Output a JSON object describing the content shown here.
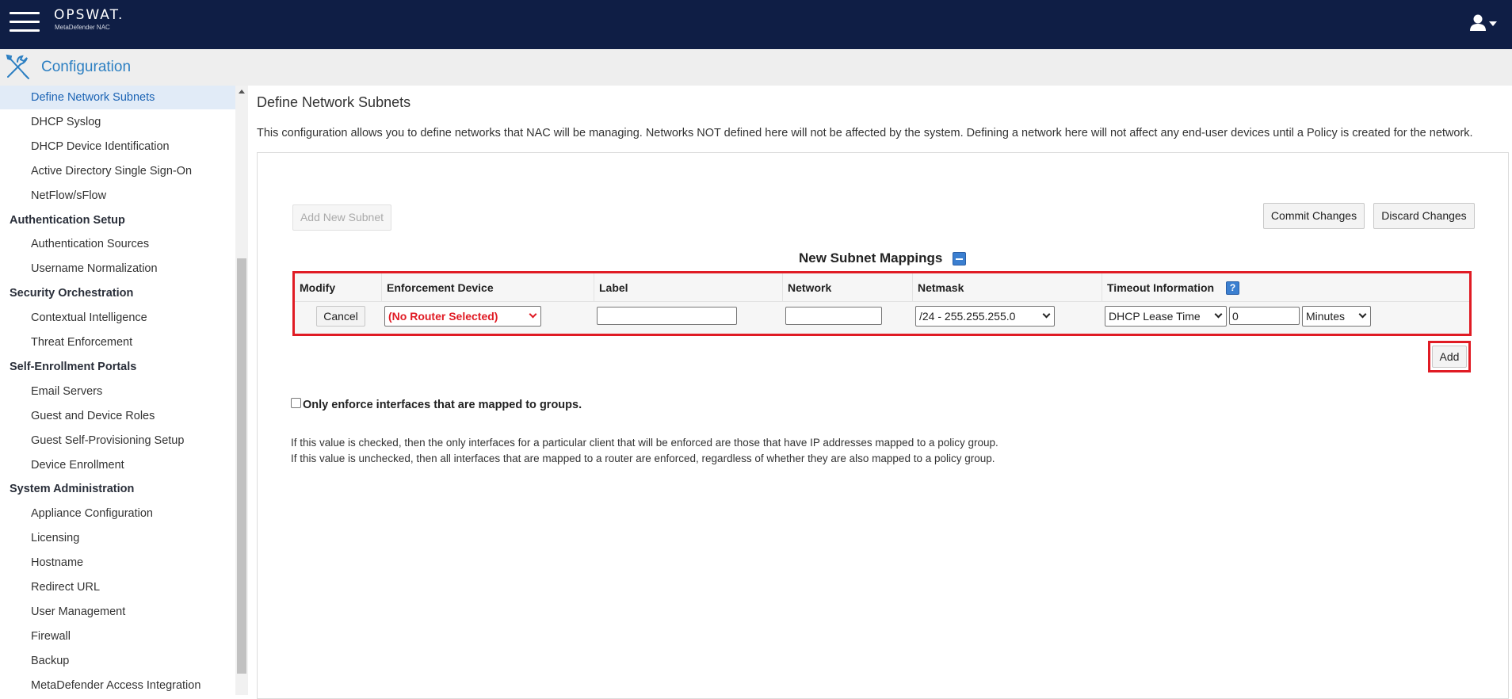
{
  "header": {
    "brand": "OPSWAT.",
    "product": "MetaDefender NAC"
  },
  "section": {
    "title": "Configuration"
  },
  "sidebar": {
    "items": [
      {
        "label": "Define Network Subnets",
        "type": "sub",
        "active": true
      },
      {
        "label": "DHCP Syslog",
        "type": "sub"
      },
      {
        "label": "DHCP Device Identification",
        "type": "sub"
      },
      {
        "label": "Active Directory Single Sign-On",
        "type": "sub"
      },
      {
        "label": "NetFlow/sFlow",
        "type": "sub"
      },
      {
        "label": "Authentication Setup",
        "type": "group"
      },
      {
        "label": "Authentication Sources",
        "type": "sub"
      },
      {
        "label": "Username Normalization",
        "type": "sub"
      },
      {
        "label": "Security Orchestration",
        "type": "group"
      },
      {
        "label": "Contextual Intelligence",
        "type": "sub"
      },
      {
        "label": "Threat Enforcement",
        "type": "sub"
      },
      {
        "label": "Self-Enrollment Portals",
        "type": "group"
      },
      {
        "label": "Email Servers",
        "type": "sub"
      },
      {
        "label": "Guest and Device Roles",
        "type": "sub"
      },
      {
        "label": "Guest Self-Provisioning Setup",
        "type": "sub"
      },
      {
        "label": "Device Enrollment",
        "type": "sub"
      },
      {
        "label": "System Administration",
        "type": "group"
      },
      {
        "label": "Appliance Configuration",
        "type": "sub"
      },
      {
        "label": "Licensing",
        "type": "sub"
      },
      {
        "label": "Hostname",
        "type": "sub"
      },
      {
        "label": "Redirect URL",
        "type": "sub"
      },
      {
        "label": "User Management",
        "type": "sub"
      },
      {
        "label": "Firewall",
        "type": "sub"
      },
      {
        "label": "Backup",
        "type": "sub"
      },
      {
        "label": "MetaDefender Access Integration",
        "type": "sub"
      }
    ]
  },
  "main": {
    "title": "Define Network Subnets",
    "description": "This configuration allows you to define networks that NAC will be managing. Networks NOT defined here will not be affected by the system. Defining a network here will not affect any end-user devices until a Policy is created for the network.",
    "add_subnet_label": "Add New Subnet",
    "commit_label": "Commit Changes",
    "discard_label": "Discard Changes",
    "mappings_title": "New Subnet Mappings",
    "columns": {
      "modify": "Modify",
      "device": "Enforcement Device",
      "label": "Label",
      "network": "Network",
      "netmask": "Netmask",
      "timeout": "Timeout Information"
    },
    "row": {
      "cancel_label": "Cancel",
      "device_value": "(No Router Selected)",
      "label_value": "",
      "network_value": "",
      "netmask_value": "/24 - 255.255.255.0",
      "timeout_type": "DHCP Lease Time",
      "timeout_value": "0",
      "timeout_unit": "Minutes"
    },
    "add_label": "Add",
    "checkbox_label": "Only enforce interfaces that are mapped to groups.",
    "checkbox_checked": false,
    "note_checked": "If this value is checked, then the only interfaces for a particular client that will be enforced are those that have IP addresses mapped to a policy group.",
    "note_unchecked": "If this value is unchecked, then all interfaces that are mapped to a router are enforced, regardless of whether they are also mapped to a policy group."
  },
  "colors": {
    "topbar": "#0f1e45",
    "accent": "#2c7fc2",
    "highlight": "#e01b24",
    "active_item_bg": "#e1ebf7"
  }
}
